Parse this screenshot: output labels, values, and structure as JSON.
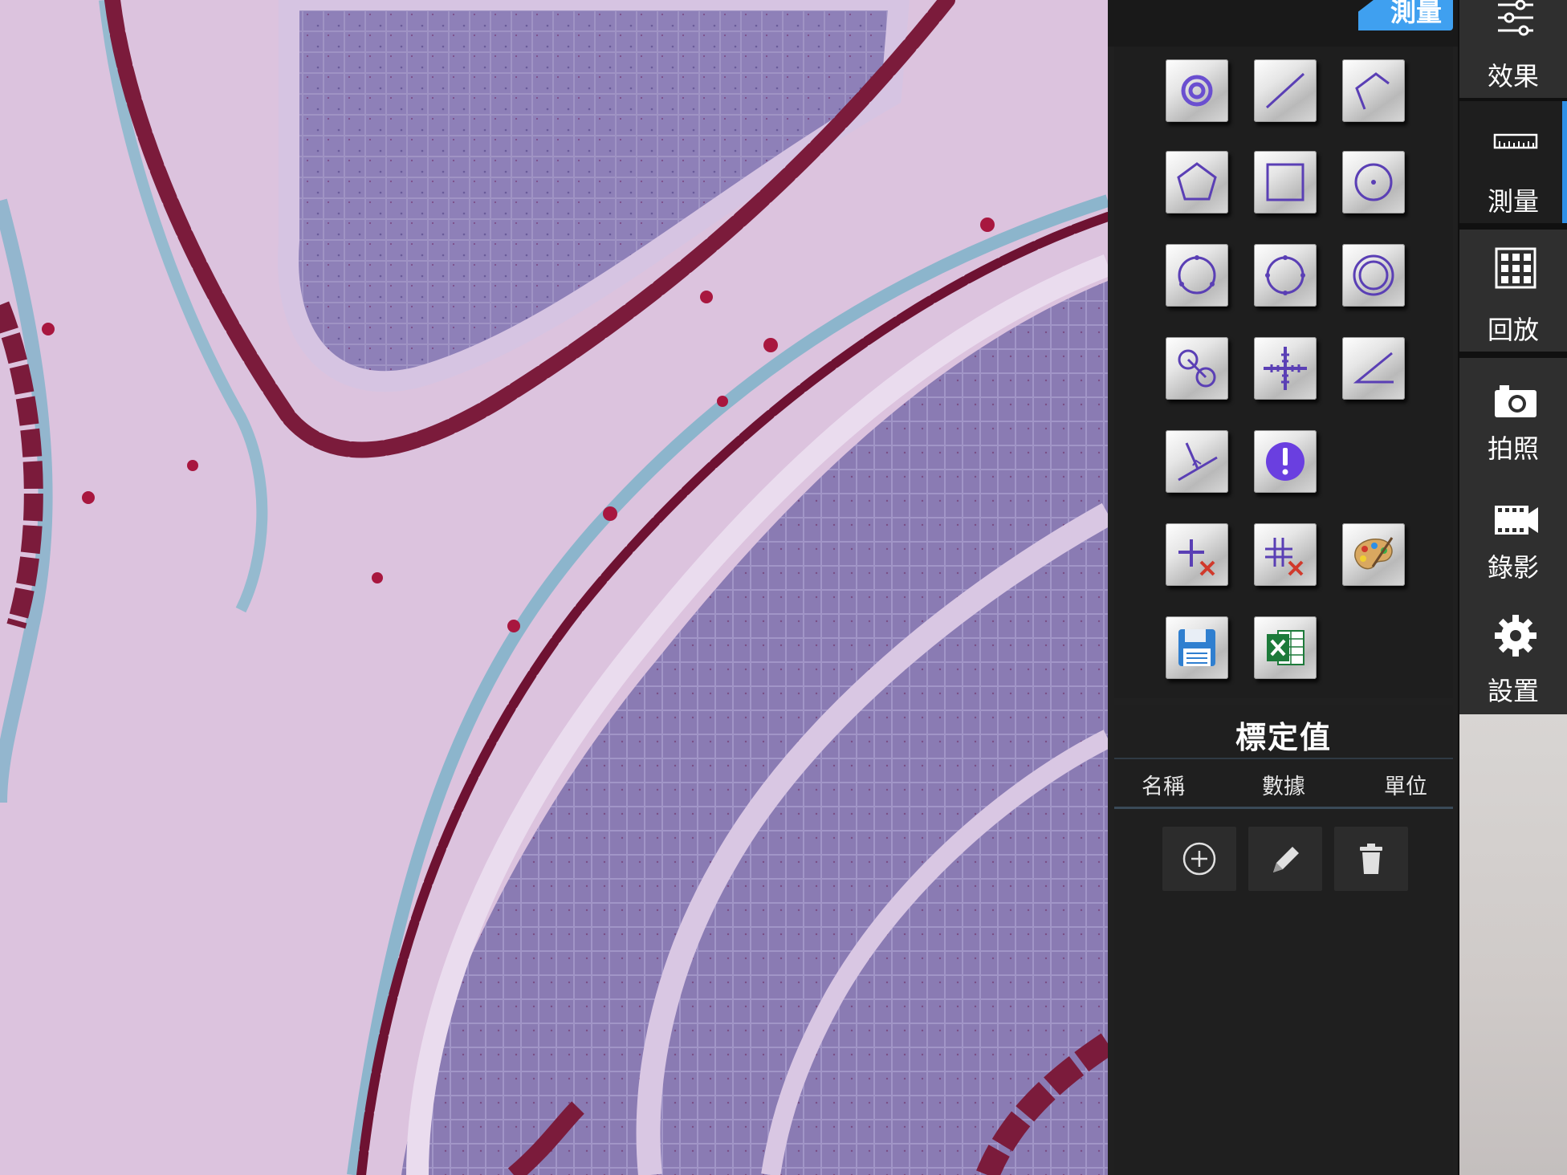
{
  "panel": {
    "tab_label": "測量",
    "tools": [
      {
        "name": "point-tool",
        "icon": "ring-point-icon"
      },
      {
        "name": "line-tool",
        "icon": "line-icon"
      },
      {
        "name": "polyline-tool",
        "icon": "polyline-icon"
      },
      {
        "name": "polygon-tool",
        "icon": "pentagon-icon"
      },
      {
        "name": "rectangle-tool",
        "icon": "square-icon"
      },
      {
        "name": "circle-center-tool",
        "icon": "circle-center-icon"
      },
      {
        "name": "circle-three-point-tool",
        "icon": "circle-three-point-icon"
      },
      {
        "name": "circle-four-point-tool",
        "icon": "circle-four-point-icon"
      },
      {
        "name": "concentric-circle-tool",
        "icon": "concentric-circle-icon"
      },
      {
        "name": "two-circle-distance-tool",
        "icon": "two-circle-icon"
      },
      {
        "name": "crosshair-tool",
        "icon": "crosshair-ruler-icon"
      },
      {
        "name": "angle-tool",
        "icon": "angle-icon"
      },
      {
        "name": "perpendicular-tool",
        "icon": "perpendicular-icon"
      },
      {
        "name": "info-tool",
        "icon": "exclamation-icon"
      },
      {
        "name": "delete-selected-tool",
        "icon": "cross-delete-icon"
      },
      {
        "name": "delete-all-tool",
        "icon": "multi-cross-delete-icon"
      },
      {
        "name": "color-palette-tool",
        "icon": "palette-icon"
      },
      {
        "name": "save-tool",
        "icon": "floppy-disk-icon"
      },
      {
        "name": "export-excel-tool",
        "icon": "excel-icon"
      }
    ],
    "calibration": {
      "title": "標定值",
      "columns": [
        "名稱",
        "數據",
        "單位"
      ],
      "buttons": [
        "add-icon",
        "pencil-icon",
        "trash-icon"
      ]
    }
  },
  "nav": {
    "items": [
      {
        "label": "效果",
        "icon": "sliders-icon"
      },
      {
        "label": "測量",
        "icon": "ruler-icon",
        "active": true
      },
      {
        "label": "回放",
        "icon": "grid-icon"
      },
      {
        "label": "拍照",
        "icon": "camera-icon"
      },
      {
        "label": "錄影",
        "icon": "film-icon"
      },
      {
        "label": "設置",
        "icon": "gear-icon"
      }
    ]
  },
  "colors": {
    "accent": "#3fa0f0",
    "tool_stroke": "#5a3fb5",
    "panel_bg": "#202020",
    "nav_bg": "#2f2f2f"
  }
}
